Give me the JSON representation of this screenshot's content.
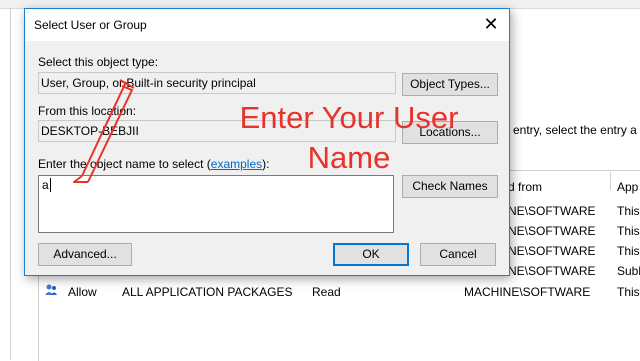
{
  "dialog": {
    "title": "Select User or Group",
    "object_type_label": "Select this object type:",
    "object_type_value": "User, Group, or Built-in security principal",
    "object_types_button": "Object Types...",
    "location_label": "From this location:",
    "location_value": "DESKTOP-BEBJII",
    "locations_button": "Locations...",
    "enter_label_prefix": "Enter the object name to select (",
    "examples_link": "examples",
    "enter_label_suffix": "):",
    "name_value": "a",
    "check_names_button": "Check Names",
    "advanced_button": "Advanced...",
    "ok_button": "OK",
    "cancel_button": "Cancel"
  },
  "background": {
    "info_text": "entry, select the entry a",
    "headers": [
      "d from",
      "App"
    ],
    "rows": [
      {
        "inherited": "NE\\SOFTWARE",
        "applies": "This"
      },
      {
        "inherited": "NE\\SOFTWARE",
        "applies": "This"
      },
      {
        "inherited": "NE\\SOFTWARE",
        "applies": "This"
      },
      {
        "inherited": "NE\\SOFTWARE",
        "applies": "Subk"
      }
    ],
    "last_row": {
      "type": "Allow",
      "principal": "ALL APPLICATION PACKAGES",
      "access": "Read",
      "inherited": "MACHINE\\SOFTWARE",
      "applies": "This"
    }
  },
  "annotation": {
    "line1": "Enter Your User",
    "line2": "Name",
    "color": "#e8332a"
  }
}
